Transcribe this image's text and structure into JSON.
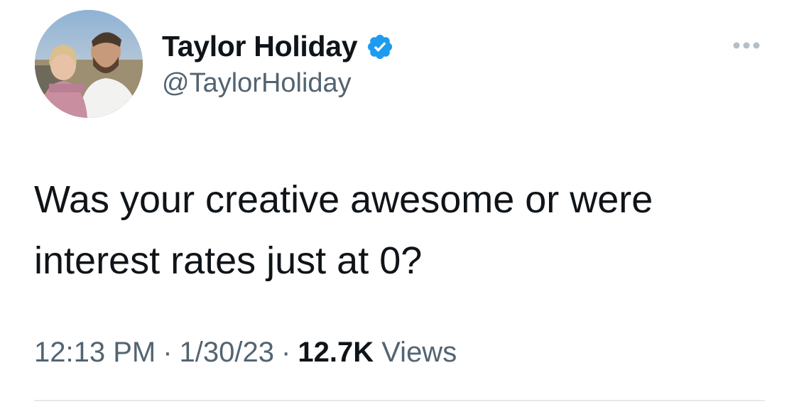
{
  "author": {
    "display_name": "Taylor Holiday",
    "handle": "@TaylorHoliday",
    "verified": true,
    "avatar_icon": "profile-photo"
  },
  "tweet": {
    "text": "Was your creative awesome or were interest rates just at 0?",
    "time": "12:13 PM",
    "date": "1/30/23",
    "separator": "·",
    "views_count": "12.7K",
    "views_label": "Views"
  },
  "icons": {
    "more": "more-options-icon",
    "verified": "verified-badge-icon"
  },
  "colors": {
    "verified_blue": "#1d9bf0",
    "text_primary": "#0f1419",
    "text_secondary": "#536471",
    "divider": "#e6e9eb"
  }
}
